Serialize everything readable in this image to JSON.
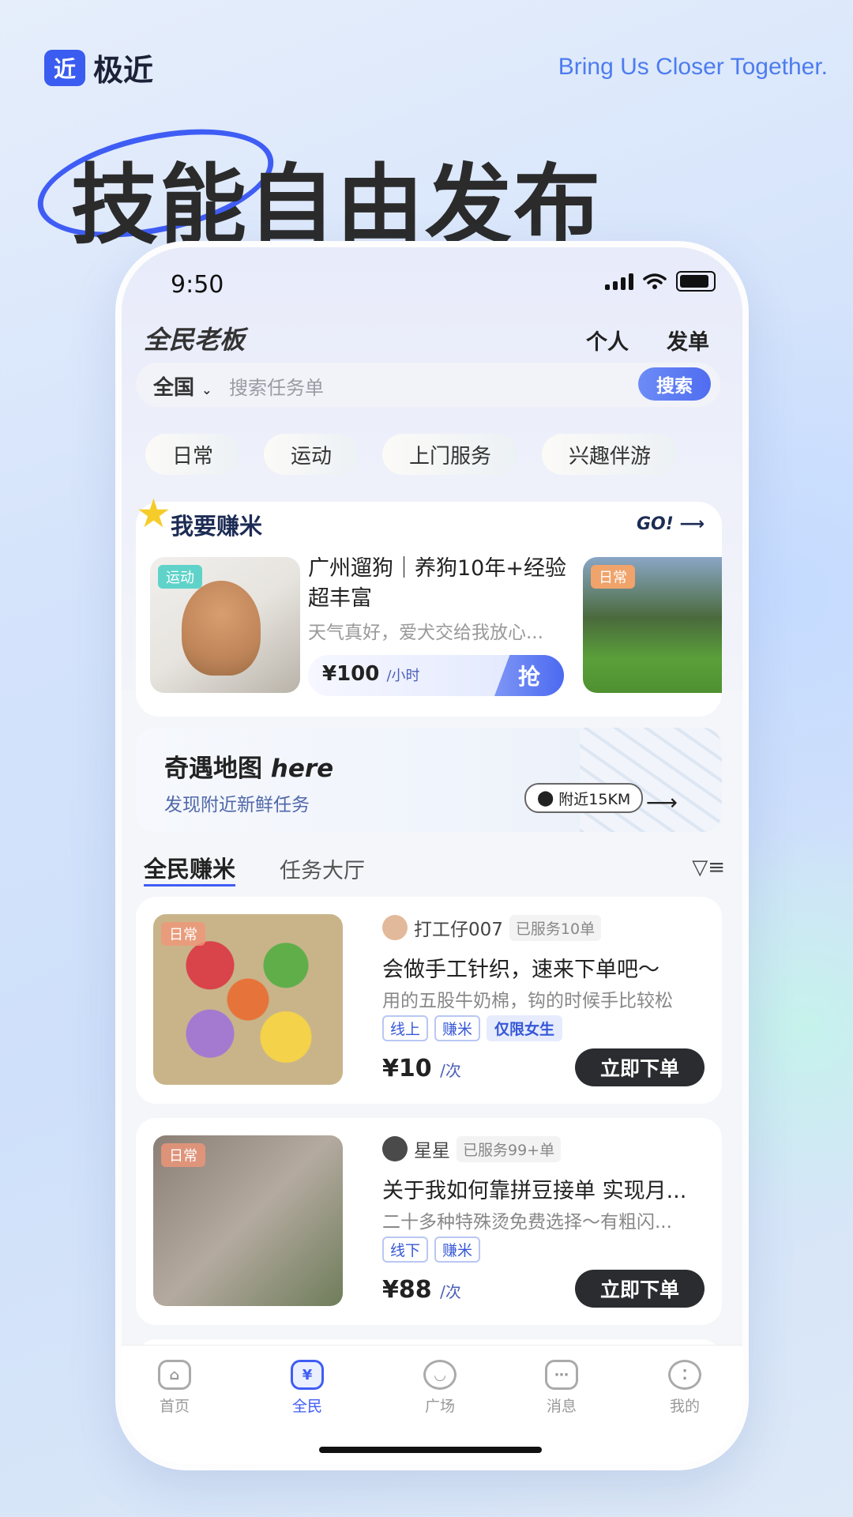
{
  "brand": {
    "badge": "近",
    "name": "极近",
    "slogan": "Bring Us Closer Together."
  },
  "headline": "技能自由发布",
  "status": {
    "time": "9:50"
  },
  "header": {
    "title": "全民老板",
    "link_personal": "个人",
    "link_post": "发单"
  },
  "search": {
    "region": "全国",
    "placeholder": "搜索任务单",
    "button": "搜索"
  },
  "categories": [
    "日常",
    "运动",
    "上门服务",
    "兴趣伴游"
  ],
  "earn": {
    "title": "我要赚米",
    "go": "GO!",
    "item": {
      "tag": "运动",
      "title": "广州遛狗｜养狗10年+经验超丰富",
      "subtitle": "天气真好，爱犬交给我放心...",
      "price": "¥100",
      "unit": "/小时",
      "grab": "抢"
    },
    "next_tag": "日常"
  },
  "map": {
    "title_cn": "奇遇地图",
    "title_en": "here",
    "subtitle": "发现附近新鲜任务",
    "nearby": "附近15KM"
  },
  "tabs": {
    "active": "全民赚米",
    "inactive": "任务大厅"
  },
  "listings": [
    {
      "tag": "日常",
      "user": "打工仔007",
      "served": "已服务10单",
      "title": "会做手工针织，速来下单吧～",
      "subtitle": "用的五股牛奶棉，钩的时候手比较松",
      "tags": [
        "线上",
        "赚米",
        "仅限女生"
      ],
      "price": "¥10",
      "unit": "/次",
      "button": "立即下单"
    },
    {
      "tag": "日常",
      "user": "星星",
      "served": "已服务99+单",
      "title": "关于我如何靠拼豆接单 实现月...",
      "subtitle": "二十多种特殊烫免费选择～有粗闪...",
      "tags": [
        "线下",
        "赚米"
      ],
      "price": "¥88",
      "unit": "/次",
      "button": "立即下单"
    }
  ],
  "tabbar": [
    {
      "label": "首页",
      "icon": "home-icon"
    },
    {
      "label": "全民",
      "icon": "yuan-clipboard-icon",
      "active": true
    },
    {
      "label": "广场",
      "icon": "planet-icon"
    },
    {
      "label": "消息",
      "icon": "chat-icon"
    },
    {
      "label": "我的",
      "icon": "face-icon"
    }
  ],
  "colors": {
    "accent": "#3f5df4",
    "dark_button": "#2b2c30"
  }
}
